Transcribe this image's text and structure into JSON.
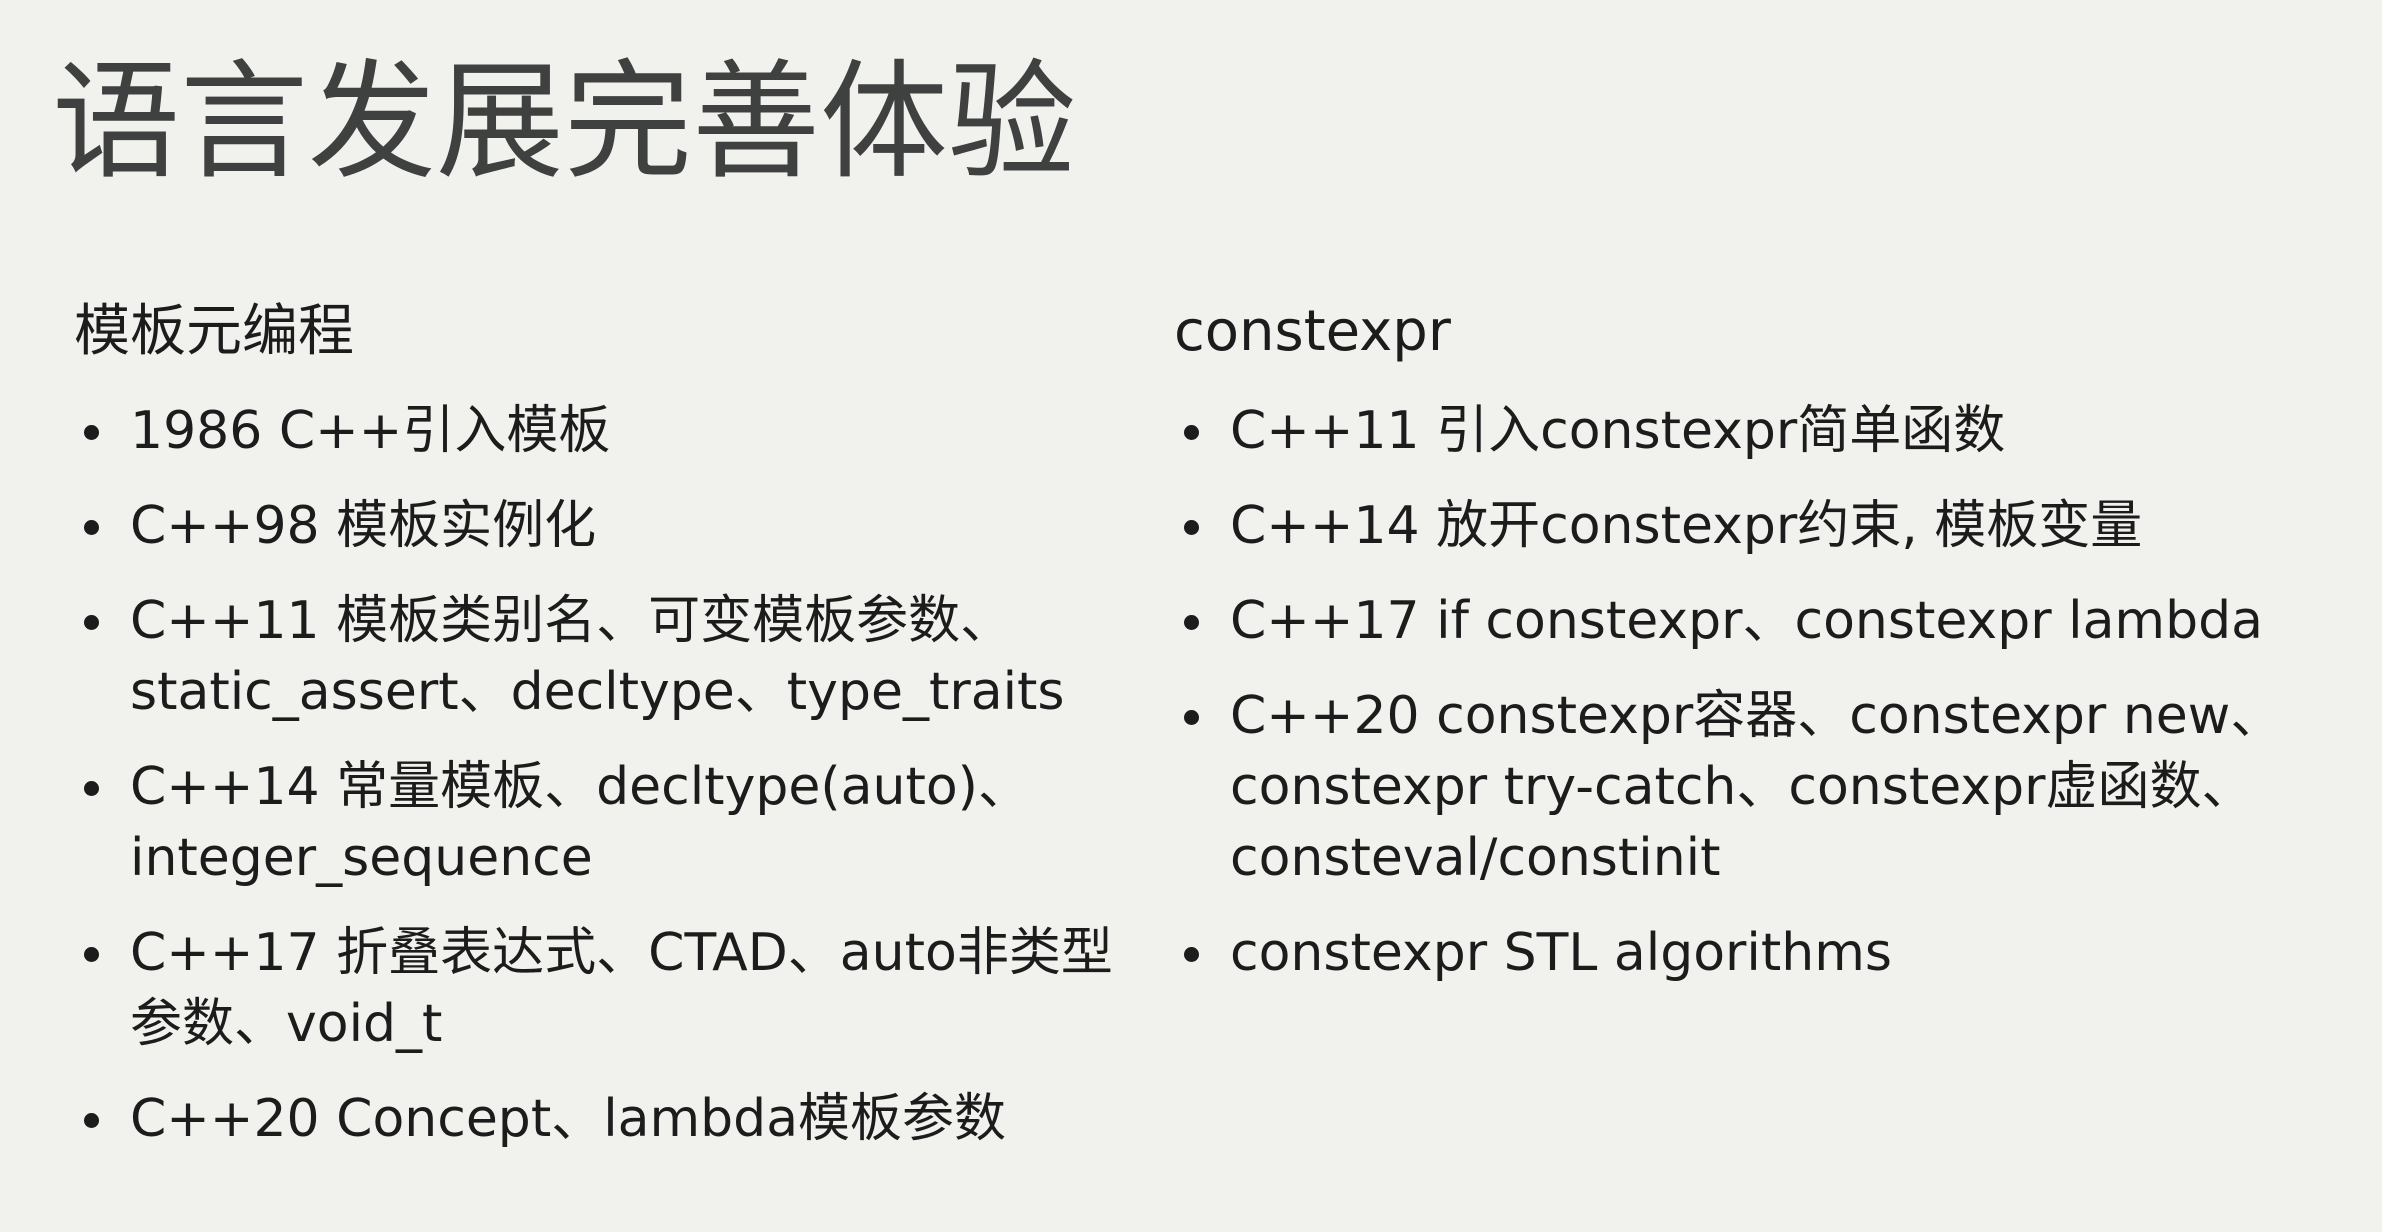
{
  "slide": {
    "title": "语言发展完善体验",
    "left_column": {
      "heading": "模板元编程",
      "items": [
        "1986 C++引入模板",
        "C++98 模板实例化",
        "C++11 模板类别名、可变模板参数、static_assert、decltype、type_traits",
        "C++14 常量模板、decltype(auto)、integer_sequence",
        "C++17 折叠表达式、CTAD、auto非类型参数、void_t",
        "C++20 Concept、lambda模板参数"
      ]
    },
    "right_column": {
      "heading": "constexpr",
      "items": [
        "C++11 引入constexpr简单函数",
        "C++14 放开constexpr约束, 模板变量",
        "C++17 if constexpr、constexpr lambda",
        "C++20 constexpr容器、constexpr new、constexpr try-catch、constexpr虚函数、consteval/constinit",
        "constexpr STL algorithms"
      ]
    }
  }
}
